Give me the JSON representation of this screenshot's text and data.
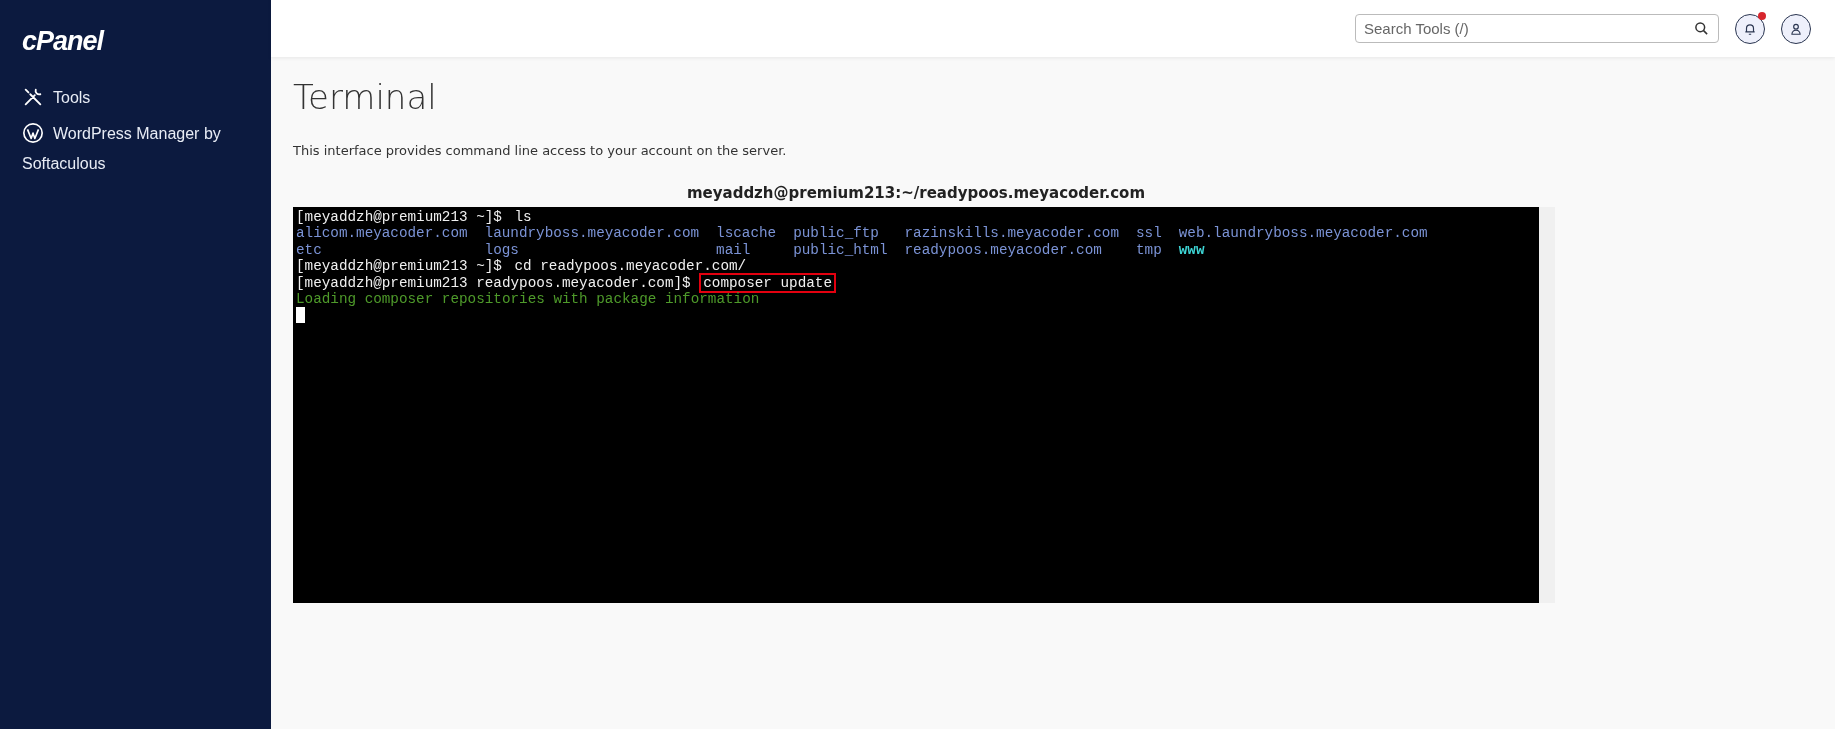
{
  "sidebar": {
    "logo": "cPanel",
    "items": [
      {
        "kind": "tools",
        "label": "Tools"
      },
      {
        "kind": "wordpress",
        "label": "WordPress Manager by Softaculous"
      }
    ]
  },
  "header": {
    "search": {
      "placeholder": "Search Tools (/)"
    },
    "notifications": {
      "unread": true
    }
  },
  "page": {
    "title": "Terminal",
    "description": "This interface provides command line access to your account on the server."
  },
  "terminal": {
    "title": "meyaddzh@premium213:~/readypoos.meyacoder.com",
    "lines": [
      {
        "kind": "command",
        "prompt": "[meyaddzh@premium213 ~]$",
        "command": "ls",
        "highlighted": false
      },
      {
        "kind": "listing",
        "rows": [
          [
            {
              "text": "alicom.meyacoder.com",
              "kind": "dir"
            },
            {
              "text": "laundryboss.meyacoder.com",
              "kind": "dir"
            },
            {
              "text": "lscache",
              "kind": "dir"
            },
            {
              "text": "public_ftp",
              "kind": "dir"
            },
            {
              "text": "razinskills.meyacoder.com",
              "kind": "dir"
            },
            {
              "text": "ssl",
              "kind": "dir"
            },
            {
              "text": "web.laundryboss.meyacoder.com",
              "kind": "dir"
            }
          ],
          [
            {
              "text": "etc",
              "kind": "dir"
            },
            {
              "text": "logs",
              "kind": "dir"
            },
            {
              "text": "mail",
              "kind": "dir"
            },
            {
              "text": "public_html",
              "kind": "dir"
            },
            {
              "text": "readypoos.meyacoder.com",
              "kind": "dir"
            },
            {
              "text": "tmp",
              "kind": "dir"
            },
            {
              "text": "www",
              "kind": "link"
            }
          ]
        ]
      },
      {
        "kind": "command",
        "prompt": "[meyaddzh@premium213 ~]$",
        "command": "cd readypoos.meyacoder.com/",
        "highlighted": false
      },
      {
        "kind": "command",
        "prompt": "[meyaddzh@premium213 readypoos.meyacoder.com]$",
        "command": "composer update",
        "highlighted": true
      },
      {
        "kind": "output",
        "text": "Loading composer repositories with package information"
      },
      {
        "kind": "cursor"
      }
    ]
  }
}
